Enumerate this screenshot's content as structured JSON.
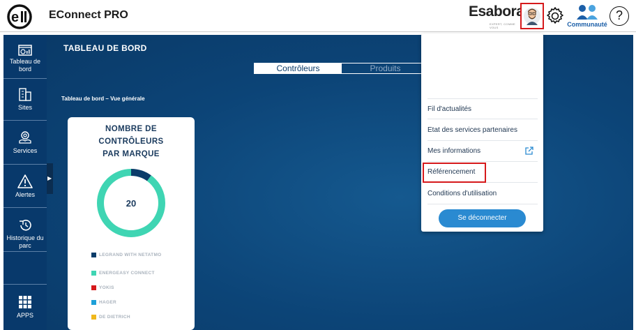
{
  "header": {
    "app_title": "EConnect PRO",
    "partner_brand": "Esabora",
    "partner_tagline": "EXPERT, COMME VOUS",
    "community_label": "Communauté",
    "help_symbol": "?"
  },
  "sidebar": {
    "items": [
      {
        "label": "Tableau de bord",
        "icon": "dashboard-icon"
      },
      {
        "label": "Sites",
        "icon": "building-icon"
      },
      {
        "label": "Services",
        "icon": "services-icon"
      },
      {
        "label": "Alertes",
        "icon": "alert-icon"
      },
      {
        "label": "Historique du parc",
        "icon": "history-icon"
      },
      {
        "label": "APPS",
        "icon": "apps-grid-icon"
      }
    ],
    "collapse_glyph": "▶"
  },
  "main": {
    "page_title": "TABLEAU DE BORD",
    "tabs": [
      {
        "label": "Contrôleurs",
        "active": true
      },
      {
        "label": "Produits",
        "active": false
      }
    ],
    "subtitle": "Tableau de bord – Vue générale"
  },
  "chart_data": {
    "type": "pie",
    "title": "NOMBRE DE CONTRÔLEURS PAR MARQUE",
    "center_label": "20",
    "categories": [
      "LEGRAND WITH NETATMO",
      "ENERGEASY CONNECT",
      "YOKIS",
      "HAGER",
      "DE DIETRICH"
    ],
    "values": [
      2,
      18,
      0,
      0,
      0
    ],
    "colors": [
      "#0b3c6a",
      "#3fd5b3",
      "#d6191b",
      "#1ea0d8",
      "#f0b81c"
    ]
  },
  "user_menu": {
    "items": [
      {
        "label": "Fil d'actualités",
        "external": false
      },
      {
        "label": "Etat des services partenaires",
        "external": false
      },
      {
        "label": "Mes informations",
        "external": true
      },
      {
        "label": "Référencement",
        "external": false
      },
      {
        "label": "Conditions d'utilisation",
        "external": false
      }
    ],
    "logout_label": "Se déconnecter"
  },
  "colors": {
    "sidebar_bg": "#08396b",
    "main_bg": "#0c4477",
    "highlight": "#d6191b",
    "button": "#2a8ad1"
  }
}
